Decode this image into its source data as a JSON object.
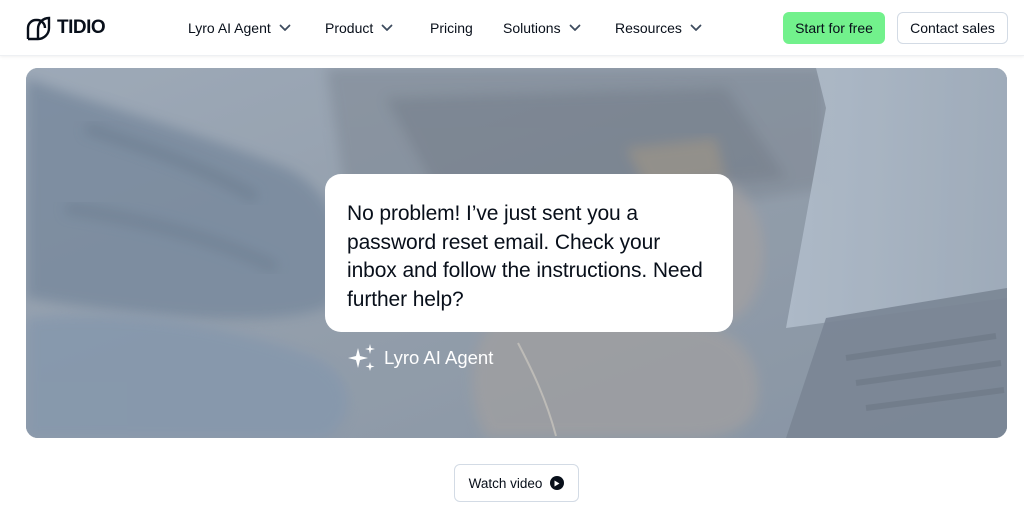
{
  "header": {
    "logo_text": "TIDIO",
    "nav": [
      {
        "label": "Lyro AI Agent",
        "has_dropdown": true
      },
      {
        "label": "Product",
        "has_dropdown": true
      },
      {
        "label": "Pricing",
        "has_dropdown": false
      },
      {
        "label": "Solutions",
        "has_dropdown": true
      },
      {
        "label": "Resources",
        "has_dropdown": true
      }
    ],
    "start_label": "Start for free",
    "contact_label": "Contact sales"
  },
  "hero": {
    "chat_message": "No problem! I’ve just sent you a password reset email. Check your inbox and follow the instructions. Need further help?",
    "agent_name": "Lyro AI Agent"
  },
  "watch_video_label": "Watch video",
  "colors": {
    "accent_green": "#72f18c",
    "text_dark": "#080f1a",
    "border": "#d3dbe5"
  }
}
